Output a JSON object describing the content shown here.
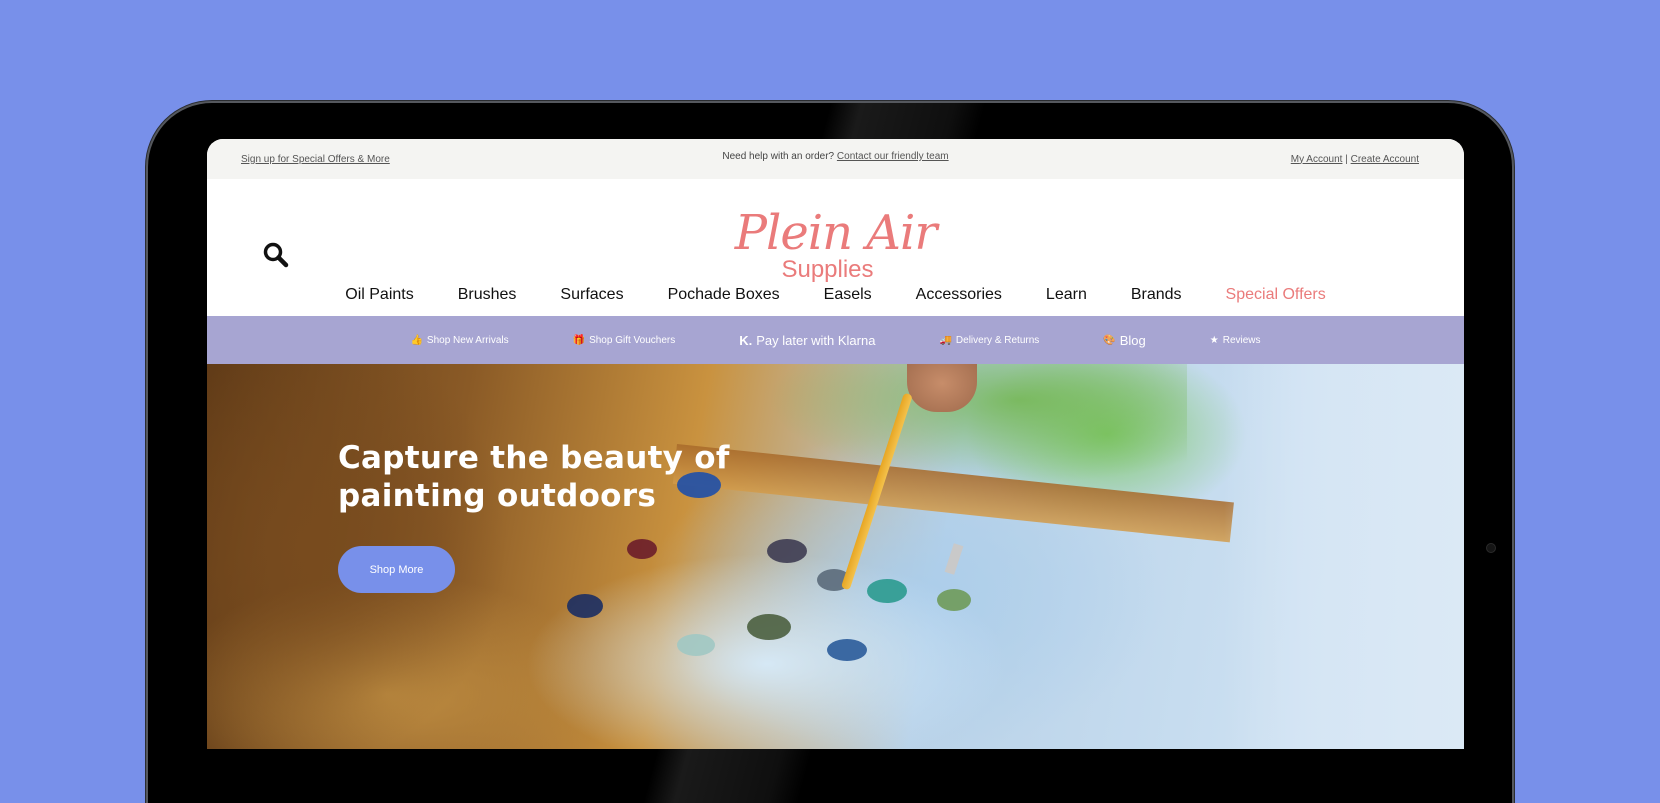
{
  "utility_bar": {
    "signup_link": "Sign up for Special Offers & More",
    "help_text": "Need help with an order?",
    "help_link": "Contact our friendly team",
    "my_account": "My Account",
    "separator": "|",
    "create_account": "Create Account"
  },
  "logo": {
    "script": "Plein Air",
    "sub": "Supplies"
  },
  "main_nav": [
    "Oil Paints",
    "Brushes",
    "Surfaces",
    "Pochade Boxes",
    "Easels",
    "Accessories",
    "Learn",
    "Brands",
    "Special Offers"
  ],
  "promo_bar": {
    "items": [
      {
        "icon": "thumbs-up-icon",
        "label": "Shop New Arrivals"
      },
      {
        "icon": "gift-icon",
        "label": "Shop Gift Vouchers"
      },
      {
        "icon": "klarna-icon",
        "label": "Pay later with Klarna"
      },
      {
        "icon": "truck-icon",
        "label": "Delivery & Returns"
      },
      {
        "icon": "palette-icon",
        "label": "Blog"
      },
      {
        "icon": "star-icon",
        "label": "Reviews"
      }
    ]
  },
  "hero": {
    "title_line1": "Capture the beauty of",
    "title_line2": "painting outdoors",
    "button": "Shop More"
  },
  "colors": {
    "background": "#7890ea",
    "accent_pink": "#ea7b7b",
    "promo_bar": "#a7a5d2",
    "button": "#7890ea"
  }
}
